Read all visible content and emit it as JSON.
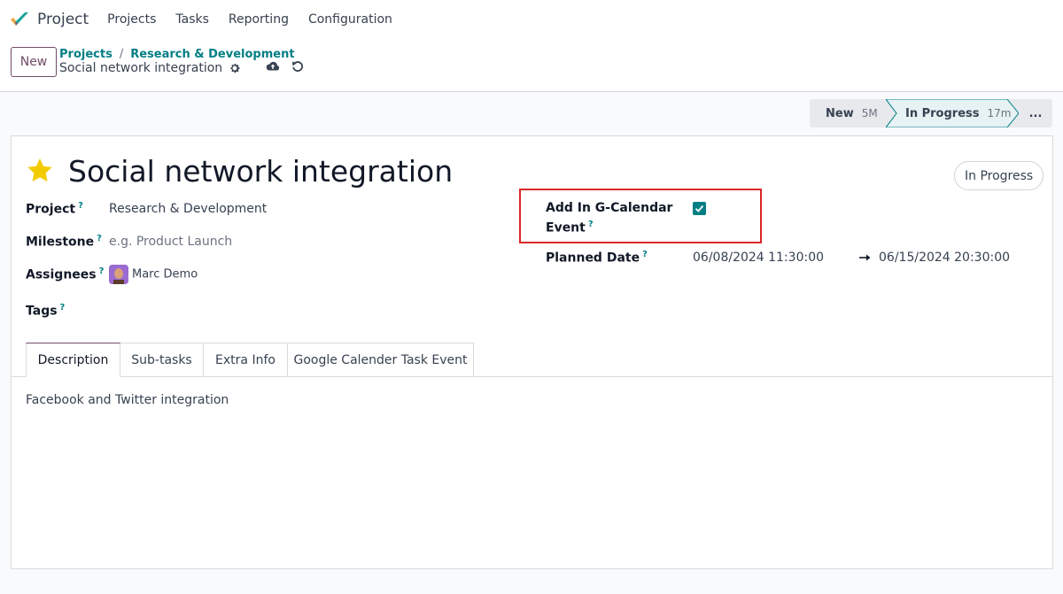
{
  "navbar": {
    "app_name": "Project",
    "menu": [
      "Projects",
      "Tasks",
      "Reporting",
      "Configuration"
    ]
  },
  "control_panel": {
    "new_button": "New",
    "breadcrumb": [
      "Projects",
      "Research & Development"
    ],
    "breadcrumb_separator": "/",
    "current_record": "Social network integration"
  },
  "statusbar": {
    "stages": [
      {
        "label": "New",
        "duration": "5M",
        "active": false
      },
      {
        "label": "In Progress",
        "duration": "17m",
        "active": true
      }
    ],
    "more": "..."
  },
  "task": {
    "title": "Social network integration",
    "starred": true,
    "status_badge": "In Progress",
    "fields": {
      "project": {
        "label": "Project",
        "value": "Research & Development"
      },
      "milestone": {
        "label": "Milestone",
        "placeholder": "e.g. Product Launch"
      },
      "assignees": {
        "label": "Assignees",
        "value": "Marc Demo"
      },
      "tags": {
        "label": "Tags"
      },
      "gcal": {
        "label_line1": "Add In G-Calendar",
        "label_line2": "Event",
        "checked": true
      },
      "planned_date": {
        "label": "Planned Date",
        "start": "06/08/2024 11:30:00",
        "end": "06/15/2024 20:30:00"
      }
    },
    "help_mark": "?"
  },
  "tabs": [
    {
      "label": "Description",
      "active": true
    },
    {
      "label": "Sub-tasks",
      "active": false
    },
    {
      "label": "Extra Info",
      "active": false
    },
    {
      "label": "Google Calender Task Event",
      "active": false
    }
  ],
  "description": "Facebook and Twitter integration",
  "colors": {
    "brand": "#714b67",
    "teal": "#017e84",
    "star": "#f3cc00",
    "highlight_box": "#dc2626"
  }
}
